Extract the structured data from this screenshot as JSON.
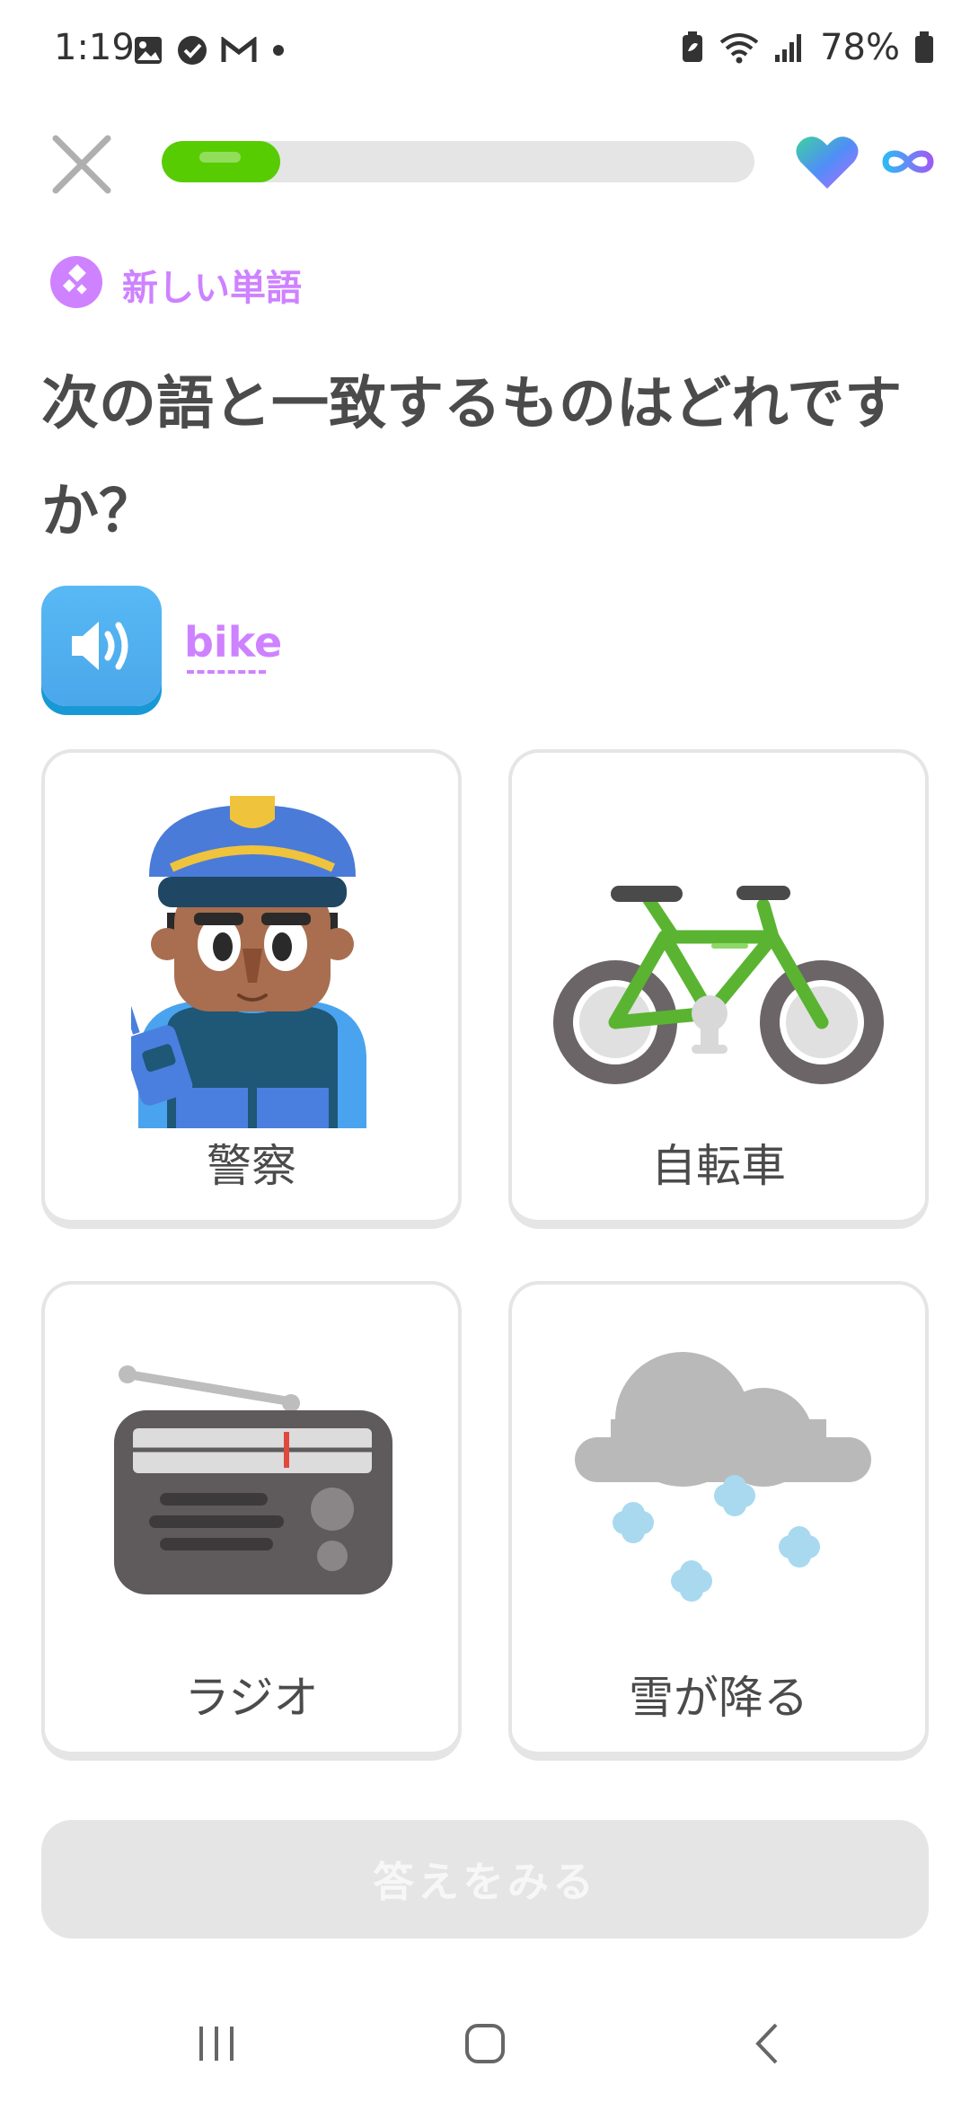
{
  "status_bar": {
    "time": "1:19",
    "battery": "78%"
  },
  "lesson": {
    "progress": 0.2,
    "badge_label": "新しい単語",
    "question": "次の語と一致するものはどれですか？",
    "word": "bike"
  },
  "choices": [
    {
      "label": "警察",
      "image": "police-officer"
    },
    {
      "label": "自転車",
      "image": "bicycle"
    },
    {
      "label": "ラジオ",
      "image": "radio"
    },
    {
      "label": "雪が降る",
      "image": "snowing-cloud"
    }
  ],
  "check_button": {
    "label": "答えをみる"
  },
  "colors": {
    "progress": "#58cc02",
    "accent_purple": "#ce82ff",
    "audio_blue": "#1cb0f6",
    "border": "#e5e5e5"
  }
}
